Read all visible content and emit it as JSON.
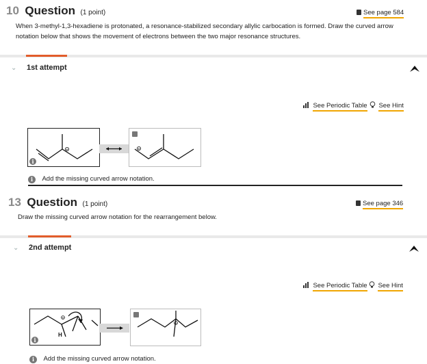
{
  "q10": {
    "number": "10",
    "word": "Question",
    "points": "(1 point)",
    "see_page": "See page 584",
    "text": "When 3-methyl-1,3-hexadiene is protonated, a resonance-stabilized secondary allylic carbocation is formed. Draw the curved arrow notation below that shows the movement of electrons between the two major resonance structures.",
    "attempt": "1st attempt",
    "periodic_table": "See Periodic Table",
    "hint": "See Hint",
    "missing": "Add the missing curved arrow notation."
  },
  "q13": {
    "number": "13",
    "word": "Question",
    "points": "(1 point)",
    "see_page": "See page 346",
    "text": "Draw the missing curved arrow notation for the rearrangement below.",
    "attempt": "2nd attempt",
    "periodic_table": "See Periodic Table",
    "hint": "See Hint",
    "missing": "Add the missing curved arrow notation.",
    "h_label": "H"
  },
  "icons": {
    "collapse": "chevron-down-icon",
    "pin": "pin-icon",
    "book": "book-icon",
    "periodic": "bar-chart-icon",
    "hint": "lightbulb-icon",
    "info": "info-icon",
    "lock": "lock-icon"
  },
  "colors": {
    "accent": "#e25c2a",
    "underline": "#f0a500"
  }
}
